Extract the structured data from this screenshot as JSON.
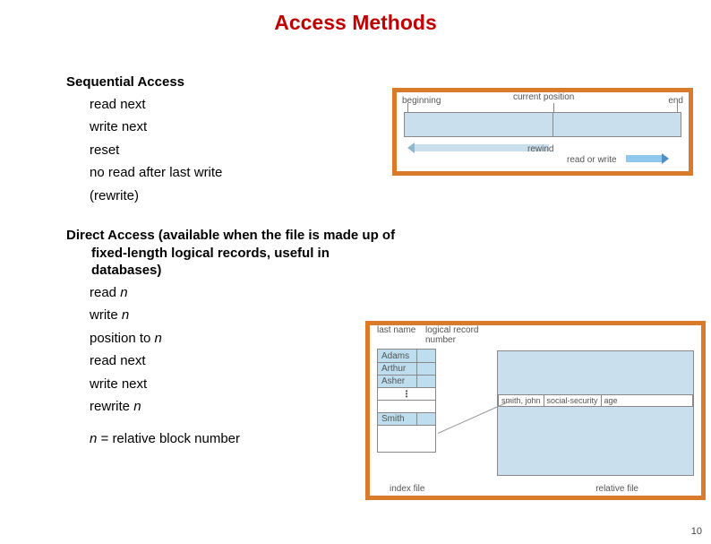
{
  "title": "Access Methods",
  "sequential": {
    "heading": "Sequential Access",
    "ops": [
      "read next",
      "write next",
      "reset",
      "no read after last write",
      "(rewrite)"
    ]
  },
  "direct": {
    "heading": "Direct Access (available when the file is made up of fixed-length logical records, useful in databases)",
    "ops": [
      {
        "pre": "read ",
        "var": "n"
      },
      {
        "pre": "write ",
        "var": "n"
      },
      {
        "pre": "position to ",
        "var": "n"
      },
      {
        "pre": "read next",
        "var": ""
      },
      {
        "pre": "write next",
        "var": ""
      },
      {
        "pre": "rewrite ",
        "var": "n"
      }
    ],
    "footnote_var": "n",
    "footnote_rest": " = relative block number"
  },
  "fig1": {
    "beginning": "beginning",
    "current_position": "current position",
    "end": "end",
    "rewind": "rewind",
    "read_or_write": "read or write"
  },
  "fig2": {
    "header_lastname": "last name",
    "header_logical": "logical record\nnumber",
    "rows": [
      "Adams",
      "Arthur",
      "Asher",
      "Smith"
    ],
    "record_fields": [
      "smith, john",
      "social-security",
      "age"
    ],
    "index_file_label": "index file",
    "relative_file_label": "relative file"
  },
  "page_number": "10"
}
